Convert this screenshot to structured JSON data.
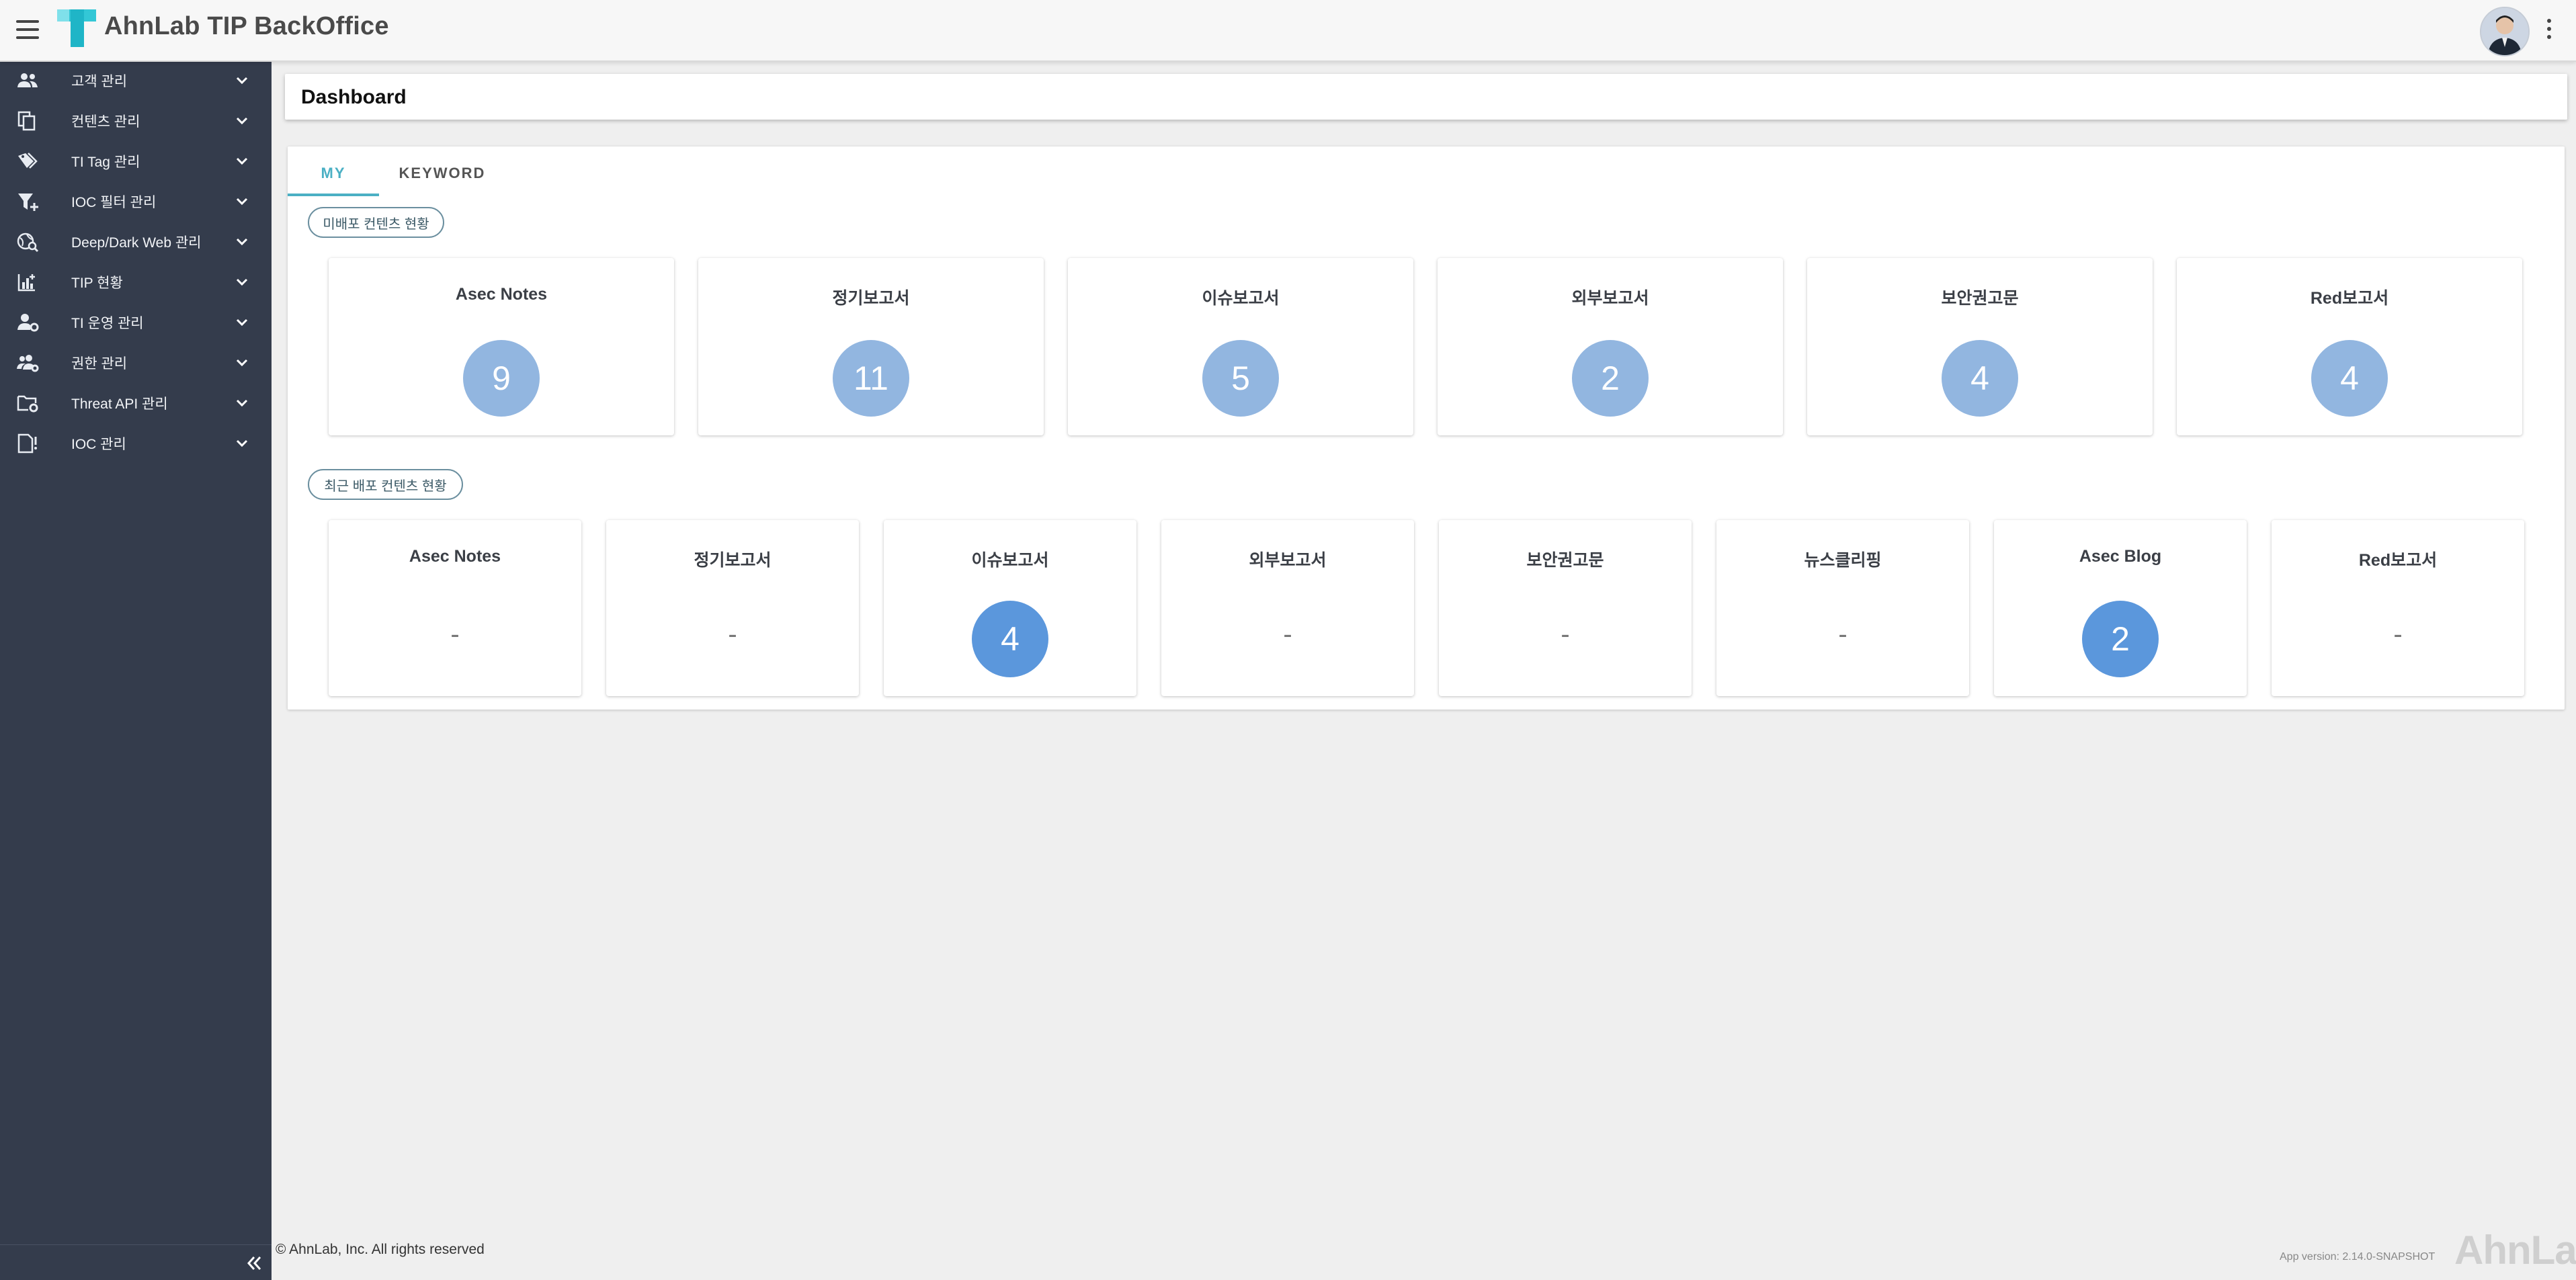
{
  "app": {
    "title": "AhnLab TIP BackOffice"
  },
  "sidebar": {
    "items": [
      {
        "label": "고객 관리",
        "icon": "people-icon"
      },
      {
        "label": "컨텐츠 관리",
        "icon": "copy-icon"
      },
      {
        "label": "TI Tag 관리",
        "icon": "tags-icon"
      },
      {
        "label": "IOC 필터 관리",
        "icon": "filter-add-icon"
      },
      {
        "label": "Deep/Dark Web 관리",
        "icon": "globe-search-icon"
      },
      {
        "label": "TIP 현황",
        "icon": "analytics-icon"
      },
      {
        "label": "TI 운영 관리",
        "icon": "person-gear-icon"
      },
      {
        "label": "권한 관리",
        "icon": "group-gear-icon"
      },
      {
        "label": "Threat API 관리",
        "icon": "folder-gear-icon"
      },
      {
        "label": "IOC 관리",
        "icon": "document-alert-icon"
      }
    ]
  },
  "page": {
    "title": "Dashboard"
  },
  "tabs": [
    {
      "label": "MY",
      "active": true
    },
    {
      "label": "KEYWORD",
      "active": false
    }
  ],
  "sections": {
    "undistributed": {
      "label": "미배포 컨텐츠 현황",
      "cards": [
        {
          "title": "Asec Notes",
          "value": "9"
        },
        {
          "title": "정기보고서",
          "value": "11"
        },
        {
          "title": "이슈보고서",
          "value": "5"
        },
        {
          "title": "외부보고서",
          "value": "2"
        },
        {
          "title": "보안권고문",
          "value": "4"
        },
        {
          "title": "Red보고서",
          "value": "4"
        }
      ]
    },
    "recent": {
      "label": "최근 배포 컨텐츠 현황",
      "cards": [
        {
          "title": "Asec Notes",
          "value": "-"
        },
        {
          "title": "정기보고서",
          "value": "-"
        },
        {
          "title": "이슈보고서",
          "value": "4"
        },
        {
          "title": "외부보고서",
          "value": "-"
        },
        {
          "title": "보안권고문",
          "value": "-"
        },
        {
          "title": "뉴스클리핑",
          "value": "-"
        },
        {
          "title": "Asec Blog",
          "value": "2"
        },
        {
          "title": "Red보고서",
          "value": "-"
        }
      ]
    }
  },
  "footer": {
    "copyright": "© AhnLab, Inc. All rights reserved",
    "version": "App version: 2.14.0-SNAPSHOT",
    "brand": "AhnLab"
  },
  "colors": {
    "sidebar_bg": "#343c4c",
    "accent": "#4bb0c4",
    "count_light": "#92b6e0",
    "count_strong": "#5b97dc"
  }
}
